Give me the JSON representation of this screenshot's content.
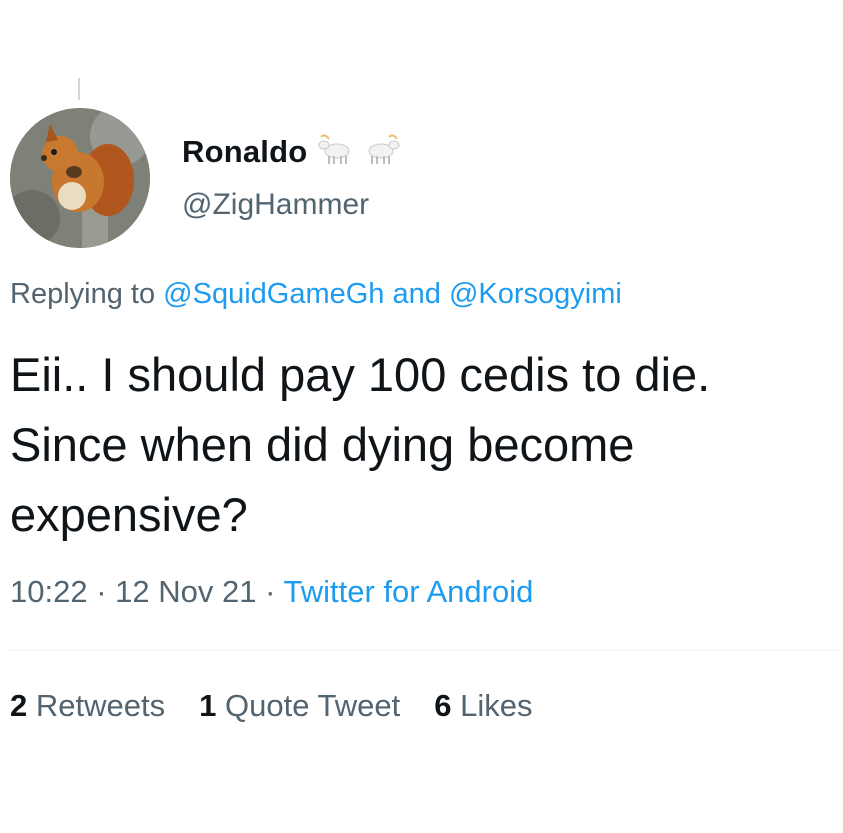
{
  "tweet": {
    "author": {
      "display_name": "Ronaldo",
      "badge_emoji": "goat-emoji",
      "handle": "@ZigHammer",
      "avatar": "squirrel-avatar"
    },
    "reply_context": {
      "prefix": "Replying to",
      "first_mention": "@SquidGameGh",
      "joiner": "and",
      "second_mention": "@Korsogyimi"
    },
    "text_lines": [
      "Eii.. I should pay 100 cedis to die.",
      "Since when did dying become",
      "expensive?"
    ],
    "timestamp": {
      "time": "10:22",
      "date": "12 Nov 21",
      "separator": "·",
      "source": "Twitter for Android"
    },
    "stats": {
      "retweets_count": "2",
      "retweets_label": "Retweets",
      "quotes_count": "1",
      "quotes_label": "Quote Tweet",
      "likes_count": "6",
      "likes_label": "Likes"
    }
  },
  "colors": {
    "text_primary": "#0f1419",
    "text_secondary": "#536471",
    "link": "#1d9bf0",
    "divider": "#eff3f4"
  }
}
